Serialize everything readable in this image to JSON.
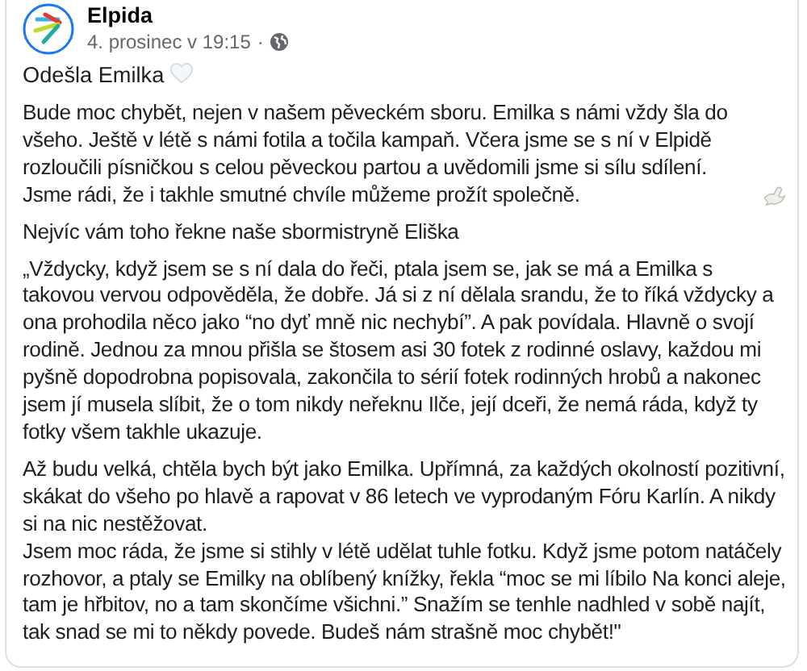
{
  "post": {
    "author": "Elpida",
    "timestamp": "4. prosinec v 19:15",
    "separator": "·",
    "title": "Odešla Emilka",
    "paragraphs": [
      {
        "text": "Bude moc chybět, nejen v našem pěveckém sboru. Emilka s námi vždy šla do všeho. Ještě v létě s námi fotila a točila kampaň. Včera jsme se s ní v Elpidě rozloučili písničkou s celou pěveckou partou a uvědomili jsme si sílu sdílení. Jsme rádi, že i takhle smutné chvíle můžeme prožít společně.",
        "kind": "dove"
      },
      {
        "text": "Nejvíc vám toho řekne naše sbormistryně Eliška",
        "kind": "plain"
      },
      {
        "text": "„Vždycky, když jsem se s ní dala do řeči, ptala jsem se, jak se má a Emilka s takovou vervou odpověděla, že dobře. Já si z ní dělala srandu, že to říká vždycky a ona prohodila něco jako “no dyť mně nic nechybí”. A pak povídala. Hlavně o svojí rodině. Jednou za mnou přišla se štosem asi 30 fotek z rodinné oslavy, každou mi pyšně dopodrobna popisovala, zakončila to sérií fotek rodinných hrobů a nakonec jsem jí musela slíbit, že o tom nikdy neřeknu Ilče, její dceři, že nemá ráda, když ty fotky všem takhle ukazuje.",
        "kind": "plain"
      },
      {
        "text": "Až budu velká, chtěla bych být jako Emilka. Upřímná, za každých okolností pozitivní, skákat do všeho po hlavě a rapovat v 86 letech ve vyprodaným Fóru Karlín. A nikdy si na nic nestěžovat.\nJsem moc ráda, že jsme si stihly v létě udělat tuhle fotku. Když jsme potom natáčely rozhovor, a ptaly se Emilky na oblíbený knížky, řekla “moc se mi líbilo Na konci aleje, tam je hřbitov, no a tam skončíme všichni.” Snažím se tenhle nadhled v sobě najít, tak snad se mi to někdy povede. Budeš nám strašně moc chybět!\"",
        "kind": "plain"
      }
    ]
  }
}
